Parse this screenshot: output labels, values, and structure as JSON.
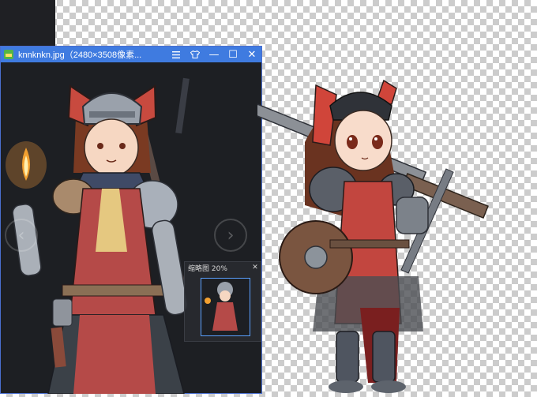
{
  "viewer": {
    "title": "knnknkn.jpg（2480×3508像素...",
    "menu_icon": "hamburger-icon",
    "skin_icon": "shirt-icon",
    "minimize_glyph": "—",
    "maximize_glyph": "☐",
    "close_glyph": "✕",
    "prev_glyph": "‹",
    "next_glyph": "›",
    "navigator": {
      "zoom_label": "缩略图 20%",
      "close_glyph": "✕"
    }
  },
  "colors": {
    "titlebar": "#3f7be0",
    "viewer_bg": "#1d1f23",
    "checker_dark": "#cccccc",
    "checker_light": "#ffffff"
  }
}
